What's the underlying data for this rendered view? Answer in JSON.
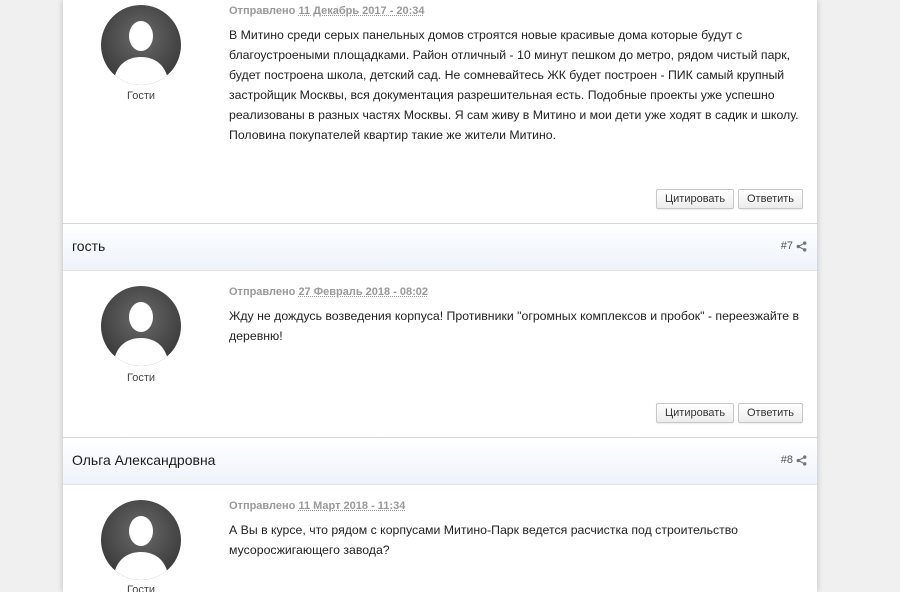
{
  "posts": [
    {
      "author": "",
      "number": "",
      "group": "Гости",
      "posted_label": "Отправлено",
      "date": "11 Декабрь 2017 - 20:34",
      "text": "В Митино среди серых панельных домов строятся новые красивые дома которые будут с благоустроеными площадками. Район отличный - 10 минут пешком до метро, рядом чистый парк, будет построена школа, детский сад. Не сомневайтесь ЖК будет построен - ПИК самый крупный застройщик Москвы, вся документация разрешительная есть. Подобные проекты уже успешно реализованы в разных частях Москвы. Я сам живу в Митино и мои дети уже ходят в садик и школу. Половина покупателей квартир такие же жители Митино.",
      "quote_label": "Цитировать",
      "reply_label": "Ответить"
    },
    {
      "author": "гость",
      "number": "#7",
      "group": "Гости",
      "posted_label": "Отправлено",
      "date": "27 Февраль 2018 - 08:02",
      "text": "Жду не дождусь возведения корпуса! Противники \"огромных комплексов и пробок\" - переезжайте в деревню!",
      "quote_label": "Цитировать",
      "reply_label": "Ответить"
    },
    {
      "author": "Ольга Александровна",
      "number": "#8",
      "group": "Гости",
      "posted_label": "Отправлено",
      "date": "11 Март 2018 - 11:34",
      "text": "А Вы в курсе, что рядом с корпусами Митино-Парк ведется расчистка под строительство мусоросжигающего завода?",
      "quote_label": "",
      "reply_label": ""
    }
  ],
  "icons": {
    "avatar": "default-user-avatar-icon",
    "share": "share-icon"
  },
  "colors": {
    "header_gradient_end": "#edf3fa",
    "avatar_fill": "#4a4a4a",
    "meta_text": "#999999",
    "body_text": "#222222"
  }
}
